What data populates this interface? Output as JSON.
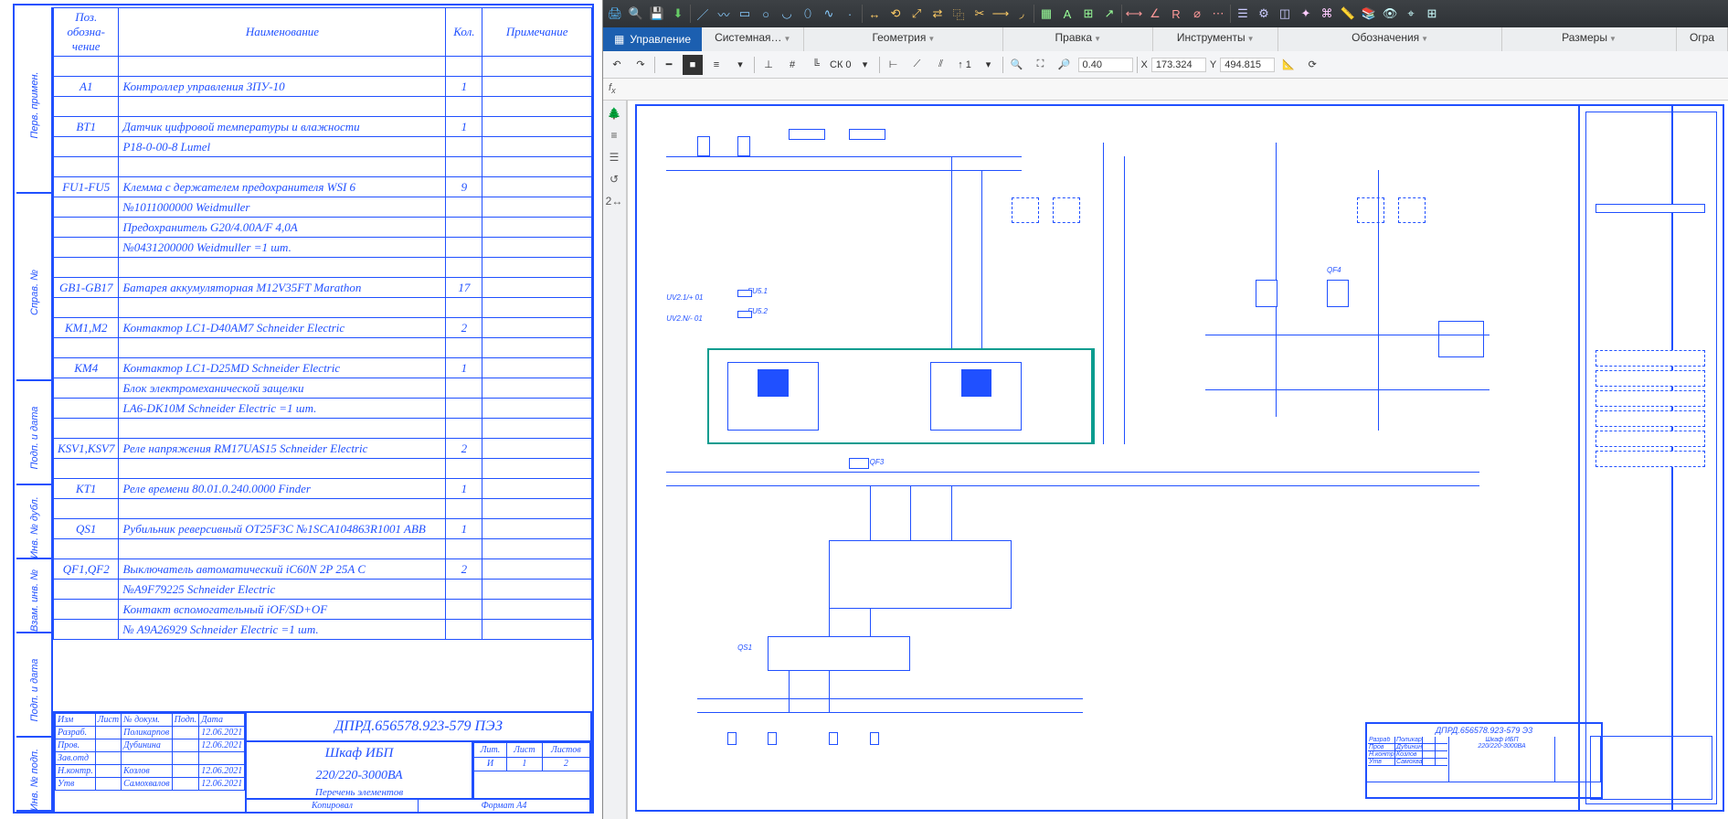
{
  "document": {
    "header": {
      "pos": "Поз. обозна-чение",
      "name": "Наименование",
      "qty": "Кол.",
      "note": "Примечание"
    },
    "rows": [
      {
        "pos": "",
        "name": "",
        "qty": "",
        "note": ""
      },
      {
        "pos": "A1",
        "name": "Контроллер управления ЗПУ-10",
        "qty": "1",
        "note": ""
      },
      {
        "pos": "",
        "name": "",
        "qty": "",
        "note": ""
      },
      {
        "pos": "BT1",
        "name": "Датчик цифровой температуры и влажности",
        "qty": "1",
        "note": ""
      },
      {
        "pos": "",
        "name": "P18-0-00-8 Lumel",
        "qty": "",
        "note": ""
      },
      {
        "pos": "",
        "name": "",
        "qty": "",
        "note": ""
      },
      {
        "pos": "FU1-FU5",
        "name": "Клемма с держателем предохранителя WSI 6",
        "qty": "9",
        "note": ""
      },
      {
        "pos": "",
        "name": "№1011000000 Weidmuller",
        "qty": "",
        "note": ""
      },
      {
        "pos": "",
        "name": "Предохранитель G20/4.00A/F 4,0А",
        "qty": "",
        "note": ""
      },
      {
        "pos": "",
        "name": "№0431200000 Weidmuller =1 шт.",
        "qty": "",
        "note": ""
      },
      {
        "pos": "",
        "name": "",
        "qty": "",
        "note": ""
      },
      {
        "pos": "GB1-GB17",
        "name": "Батарея аккумуляторная M12V35FT Marathon",
        "qty": "17",
        "note": ""
      },
      {
        "pos": "",
        "name": "",
        "qty": "",
        "note": ""
      },
      {
        "pos": "KM1,M2",
        "name": "Контактор LC1-D40AM7 Schneider Electric",
        "qty": "2",
        "note": ""
      },
      {
        "pos": "",
        "name": "",
        "qty": "",
        "note": ""
      },
      {
        "pos": "KM4",
        "name": "Контактор LC1-D25MD Schneider Electric",
        "qty": "1",
        "note": ""
      },
      {
        "pos": "",
        "name": "Блок электромеханической защелки",
        "qty": "",
        "note": ""
      },
      {
        "pos": "",
        "name": "LA6-DK10M Schneider Electric =1 шт.",
        "qty": "",
        "note": ""
      },
      {
        "pos": "",
        "name": "",
        "qty": "",
        "note": ""
      },
      {
        "pos": "KSV1,KSV7",
        "name": "Реле напряжения RM17UAS15 Schneider Electric",
        "qty": "2",
        "note": ""
      },
      {
        "pos": "",
        "name": "",
        "qty": "",
        "note": ""
      },
      {
        "pos": "KT1",
        "name": "Реле времени 80.01.0.240.0000 Finder",
        "qty": "1",
        "note": ""
      },
      {
        "pos": "",
        "name": "",
        "qty": "",
        "note": ""
      },
      {
        "pos": "QS1",
        "name": "Рубильник реверсивный OT25F3C №1SCA104863R1001 ABB",
        "qty": "1",
        "note": ""
      },
      {
        "pos": "",
        "name": "",
        "qty": "",
        "note": ""
      },
      {
        "pos": "QF1,QF2",
        "name": "Выключатель автоматический iC60N 2P 25A C",
        "qty": "2",
        "note": ""
      },
      {
        "pos": "",
        "name": "№A9F79225  Schneider Electric",
        "qty": "",
        "note": ""
      },
      {
        "pos": "",
        "name": "Контакт вспомогательный iOF/SD+OF",
        "qty": "",
        "note": ""
      },
      {
        "pos": "",
        "name": "№ A9A26929 Schneider Electric =1 шт.",
        "qty": "",
        "note": ""
      }
    ],
    "side_labels": [
      "Перв. примен.",
      "Справ. №",
      "Подп. и дата",
      "Инв. № дубл.",
      "Взам. инв. №",
      "Подп. и дата",
      "Инв. № подп."
    ],
    "title_block": {
      "doc_number": "ДПРД.656578.923-579  ПЭЗ",
      "title": "Шкаф ИБП",
      "subtitle": "220/220-3000ВА",
      "sub2": "Перечень элементов",
      "signers": [
        {
          "role": "Изм",
          "c2": "Лист",
          "c3": "№ докум.",
          "c4": "Подп.",
          "c5": "Дата"
        },
        {
          "role": "Разраб.",
          "c2": "",
          "c3": "Поликарпов",
          "c4": "",
          "c5": "12.06.2021"
        },
        {
          "role": "Пров.",
          "c2": "",
          "c3": "Дубинина",
          "c4": "",
          "c5": "12.06.2021"
        },
        {
          "role": "Зав.отд",
          "c2": "",
          "c3": "",
          "c4": "",
          "c5": ""
        },
        {
          "role": "Н.контр.",
          "c2": "",
          "c3": "Козлов",
          "c4": "",
          "c5": "12.06.2021"
        },
        {
          "role": "Утв",
          "c2": "",
          "c3": "Самохвалов",
          "c4": "",
          "c5": "12.06.2021"
        }
      ],
      "lit_label": "Лит.",
      "sheet_label": "Лист",
      "sheets_label": "Листов",
      "lit": "И",
      "sheet": "1",
      "sheets": "2",
      "footer_copy": "Копировал",
      "footer_fmt": "Формат    А4"
    }
  },
  "cad": {
    "mgmt": "Управление",
    "tabs": [
      "Системная…",
      "Геометрия",
      "Правка",
      "Инструменты",
      "Обозначения",
      "Размеры",
      "Огра"
    ],
    "toolbar2": {
      "ck": "СК 0",
      "zoom": "0.40",
      "xlabel": "X",
      "x": "173.324",
      "ylabel": "Y",
      "y": "494.815"
    },
    "mini_tb": {
      "doc": "ДПРД.656578.923-579 Э3",
      "title": "Шкаф ИБП",
      "sub": "220/220-3000ВА"
    },
    "schematic_labels": {
      "uv21": "UV2.1/+ 01",
      "uv2n": "UV2.N/- 01",
      "fu51": "FU5.1",
      "fu52": "FU5.2",
      "qf3": "QF3",
      "qs1": "QS1",
      "qf4": "QF4"
    }
  }
}
